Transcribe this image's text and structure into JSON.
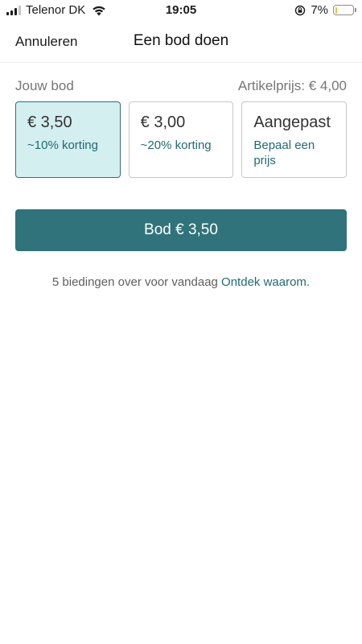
{
  "status_bar": {
    "carrier": "Telenor DK",
    "time": "19:05",
    "battery_text": "7%",
    "battery_level": 0.07,
    "icons": [
      "signal-icon",
      "wifi-icon",
      "rotation-lock-icon",
      "battery-icon"
    ]
  },
  "nav": {
    "cancel_label": "Annuleren",
    "title": "Een bod doen"
  },
  "offer": {
    "your_bid_label": "Jouw bod",
    "item_price_label": "Artikelprijs: € 4,00",
    "options": [
      {
        "price": "€ 3,50",
        "sub": "~10% korting",
        "selected": true
      },
      {
        "price": "€ 3,00",
        "sub": "~20% korting",
        "selected": false
      },
      {
        "price": "Aangepast",
        "sub": "Bepaal een prijs",
        "selected": false
      }
    ]
  },
  "bid_button_label": "Bod € 3,50",
  "info": {
    "text": "5 biedingen over voor vandaag ",
    "link": "Ontdek waarom."
  },
  "colors": {
    "accent": "#30737b",
    "selected_bg": "#d3eff0",
    "link": "#1f6b73",
    "battery": "#f2c230"
  }
}
